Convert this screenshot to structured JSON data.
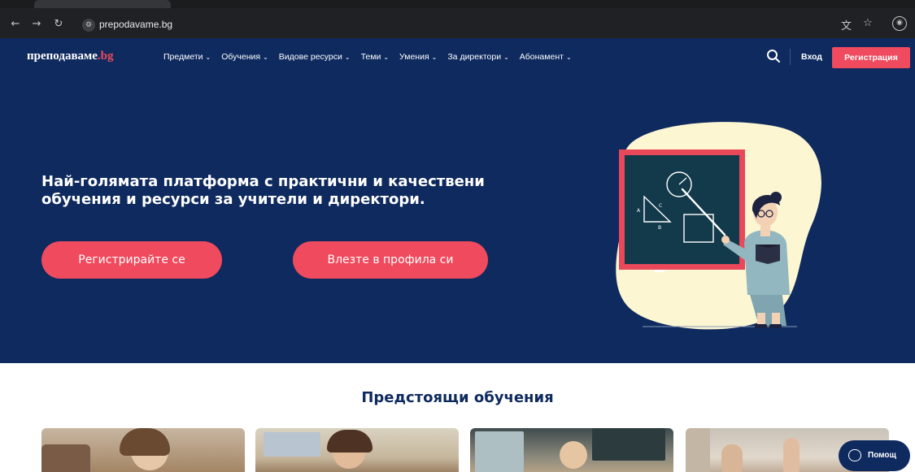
{
  "browser": {
    "url": "prepodavame.bg",
    "icons": [
      "back-icon",
      "forward-icon",
      "reload-icon",
      "site-settings-icon",
      "translate-icon",
      "bookmark-star-icon",
      "profile-icon"
    ]
  },
  "site": {
    "logo": {
      "text": "преподаваме",
      "tld": ".bg"
    },
    "nav": {
      "items": [
        "Предмети",
        "Обучения",
        "Видове ресурси",
        "Теми",
        "Умения",
        "За директори",
        "Абонамент"
      ],
      "login": "Вход",
      "register": "Регистрация"
    },
    "hero": {
      "title_line1": "Най-голямата платформа с практични и качествени",
      "title_line2": "обучения и ресурси за учители и директори.",
      "cta_register": "Регистрирайте се",
      "cta_login": "Влезте в профила си"
    },
    "upcoming": {
      "title": "Предстоящи обучения"
    },
    "help": "Помощ"
  },
  "colors": {
    "navy": "#0e2a5f",
    "accent": "#ef4a5d",
    "cream": "#fdf6d2"
  }
}
